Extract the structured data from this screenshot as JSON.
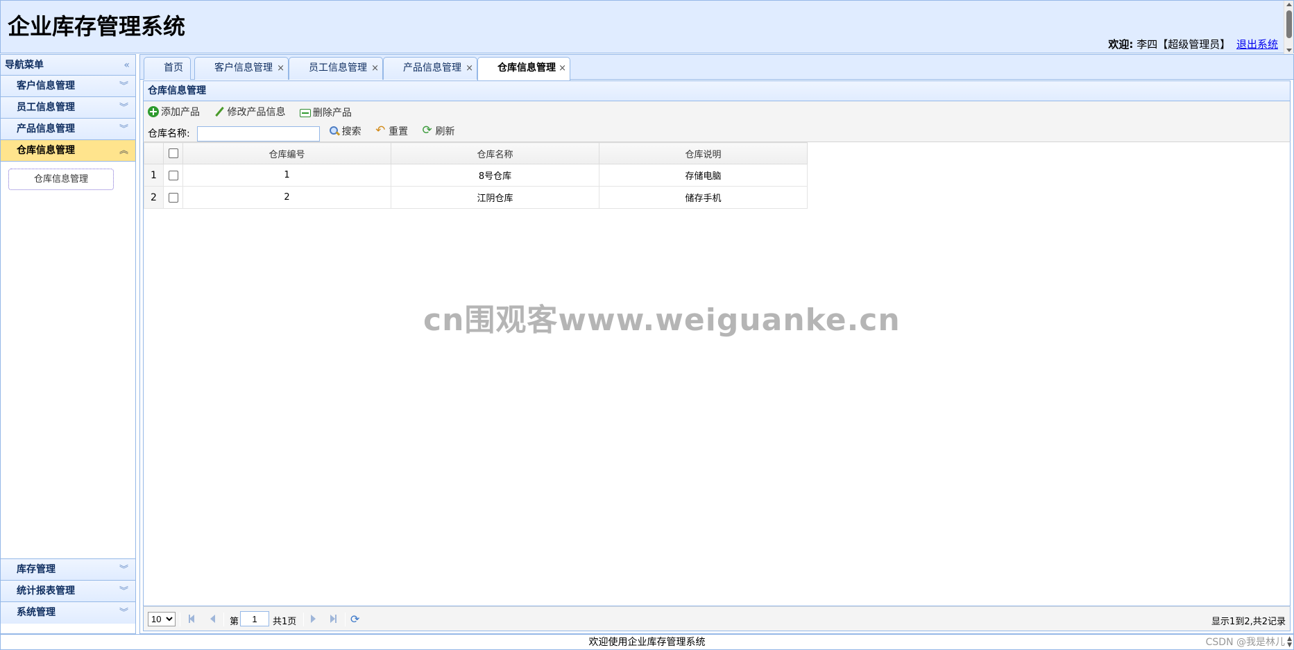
{
  "header": {
    "title": "企业库存管理系统",
    "welcome_label": "欢迎:",
    "user": "李四【超级管理员】",
    "logout": "退出系统"
  },
  "sidebar": {
    "title": "导航菜单",
    "items": [
      {
        "label": "客户信息管理"
      },
      {
        "label": "员工信息管理"
      },
      {
        "label": "产品信息管理"
      },
      {
        "label": "仓库信息管理",
        "active": true
      }
    ],
    "subitem": "仓库信息管理",
    "bottom_items": [
      {
        "label": "库存管理"
      },
      {
        "label": "统计报表管理"
      },
      {
        "label": "系统管理"
      }
    ]
  },
  "tabs": [
    {
      "label": "首页"
    },
    {
      "label": "客户信息管理"
    },
    {
      "label": "员工信息管理"
    },
    {
      "label": "产品信息管理"
    },
    {
      "label": "仓库信息管理",
      "selected": true
    }
  ],
  "panel": {
    "title": "仓库信息管理"
  },
  "toolbar": {
    "add": "添加产品",
    "edit": "修改产品信息",
    "remove": "删除产品",
    "search_label": "仓库名称:",
    "search_value": "",
    "search_btn": "搜索",
    "reset_btn": "重置",
    "refresh_btn": "刷新"
  },
  "table": {
    "columns": [
      "仓库编号",
      "仓库名称",
      "仓库说明"
    ],
    "rows": [
      {
        "num": "1",
        "id": "1",
        "name": "8号仓库",
        "desc": "存储电脑"
      },
      {
        "num": "2",
        "id": "2",
        "name": "江阴仓库",
        "desc": "储存手机"
      }
    ]
  },
  "pager": {
    "page_size": "10",
    "page_prefix": "第",
    "page_value": "1",
    "page_suffix": "共1页",
    "info": "显示1到2,共2记录"
  },
  "footer": {
    "text": "欢迎使用企业库存管理系统",
    "csdn": "CSDN @我是林儿"
  },
  "watermark": "cn围观客www.weiguanke.cn"
}
